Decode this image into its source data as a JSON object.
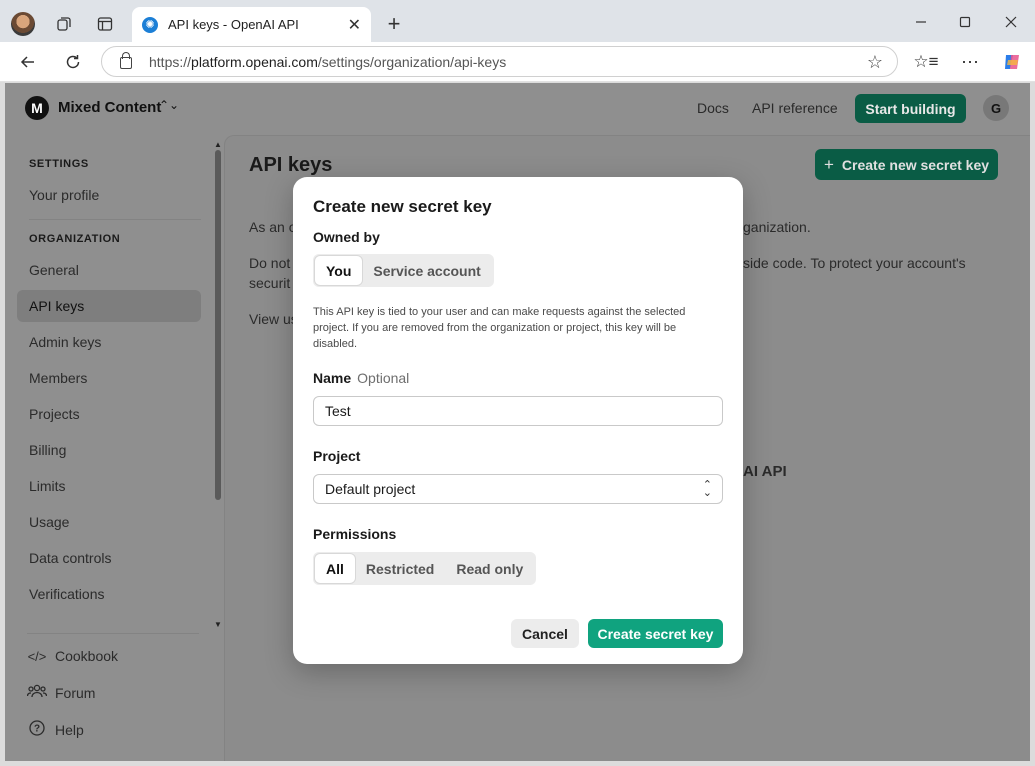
{
  "browser": {
    "tab_title": "API keys - OpenAI API",
    "url_prefix": "https://",
    "url_host": "platform.openai.com",
    "url_path": "/settings/organization/api-keys"
  },
  "topnav": {
    "org_initial": "M",
    "org_name": "Mixed Content",
    "docs": "Docs",
    "api_reference": "API reference",
    "start_building": "Start building",
    "user_initial": "G"
  },
  "sidebar": {
    "settings_heading": "SETTINGS",
    "your_profile": "Your profile",
    "organization_heading": "ORGANIZATION",
    "items": [
      "General",
      "API keys",
      "Admin keys",
      "Members",
      "Projects",
      "Billing",
      "Limits",
      "Usage",
      "Data controls",
      "Verifications"
    ],
    "active_item": "API keys",
    "bottom": [
      {
        "icon": "code-icon",
        "label": "Cookbook"
      },
      {
        "icon": "people-icon",
        "label": "Forum"
      },
      {
        "icon": "help-icon",
        "label": "Help"
      }
    ]
  },
  "content": {
    "title": "API keys",
    "create_button": "Create new secret key",
    "para1_left": "As an o",
    "para1_right": "ganization.",
    "para2_left": "Do not",
    "para2_right": "side code. To protect your account's",
    "para2_line2": "securit",
    "para3_left": "View us",
    "hidden_heading_right": "AI API"
  },
  "modal": {
    "title": "Create new secret key",
    "owned_by_label": "Owned by",
    "owner_options": [
      "You",
      "Service account"
    ],
    "owner_selected": "You",
    "help_text": "This API key is tied to your user and can make requests against the selected project. If you are removed from the organization or project, this key will be disabled.",
    "name_label": "Name",
    "name_optional": "Optional",
    "name_value": "Test",
    "project_label": "Project",
    "project_value": "Default project",
    "permissions_label": "Permissions",
    "permission_options": [
      "All",
      "Restricted",
      "Read only"
    ],
    "permission_selected": "All",
    "cancel": "Cancel",
    "create": "Create secret key"
  },
  "colors": {
    "brand_green": "#10a37f",
    "dark_green_dimmed": "#0a5c45"
  }
}
